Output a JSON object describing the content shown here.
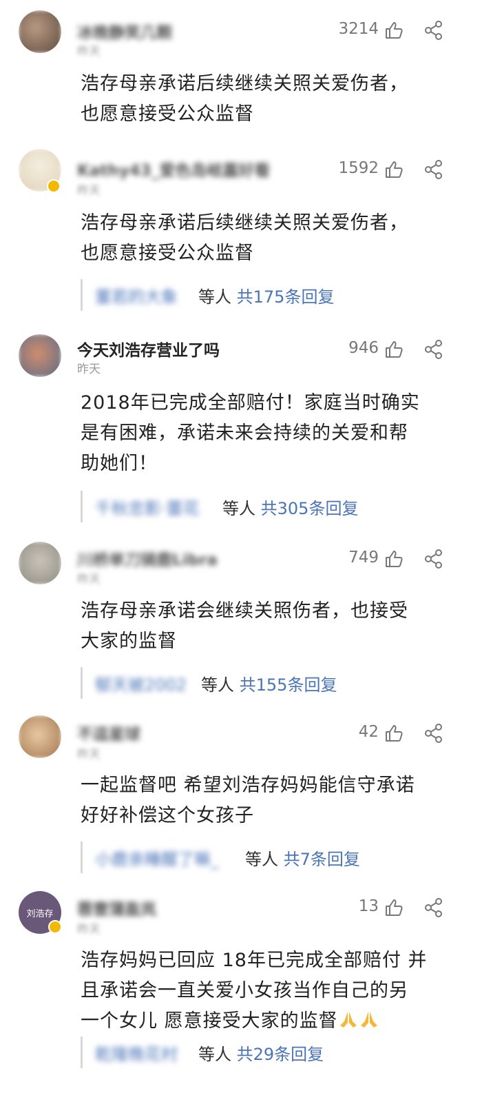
{
  "comments": [
    {
      "username": "冰晚静笑几颗",
      "time": "昨天",
      "likes": "3214",
      "text": [
        "浩存母亲承诺后续继续关照关爱伤者，",
        "也愿意接受公众监督"
      ],
      "replies": null
    },
    {
      "username": "Kathy43_爱色岛岐嘉好看",
      "time": "昨天",
      "likes": "1592",
      "text": [
        "浩存母亲承诺后续继续关照关爱伤者，",
        "也愿意接受公众监督"
      ],
      "replies": {
        "names": "董若的大象",
        "suffix": "等人",
        "count": "共175条回复"
      }
    },
    {
      "username": "今天刘浩存营业了吗",
      "time": "昨天",
      "likes": "946",
      "text": [
        "2018年已完成全部赔付！家庭当时确实",
        "是有困难，承诺未来会持续的关爱和帮",
        "助她们！"
      ],
      "replies": {
        "names": "千秋忠影·蕾花",
        "suffix": "等人",
        "count": "共305条回复"
      }
    },
    {
      "username": "川桥单刀骑鹿Libra",
      "time": "昨天",
      "likes": "749",
      "text": [
        "浩存母亲承诺会继续关照伤者，也接受",
        "大家的监督"
      ],
      "replies": {
        "names": "郁天被2002",
        "suffix": "等人",
        "count": "共155条回复"
      }
    },
    {
      "username": "不逗星球",
      "time": "昨天",
      "likes": "42",
      "text": [
        "一起监督吧 希望刘浩存妈妈能信守承诺",
        "好好补偿这个女孩子"
      ],
      "replies": {
        "names": "小鹿亲睡醒了嘛_",
        "suffix": "等人",
        "count": "共7条回复"
      }
    },
    {
      "username": "蓉壹蒲盈岚",
      "time": "昨天",
      "likes": "13",
      "avatar_text": "刘浩存",
      "text": [
        "浩存妈妈已回应 18年已完成全部赔付 并",
        "且承诺会一直关爱小女孩当作自己的另",
        "一个女儿 愿意接受大家的监督"
      ],
      "replies": {
        "names": "乾隆晚花村",
        "suffix": "等人",
        "count": "共29条回复"
      }
    }
  ],
  "colors": {
    "link": "#4a74b8",
    "muted": "#999999",
    "text": "#222222",
    "accent": "#f5b800"
  },
  "icons": {
    "like": "thumbs-up-icon",
    "share": "share-icon",
    "emoji": "praying-hands-emoji"
  }
}
